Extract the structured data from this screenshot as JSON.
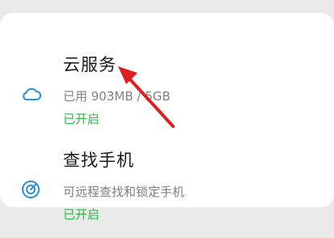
{
  "items": [
    {
      "title": "云服务",
      "subtitle": "已用 903MB / 5GB",
      "status": "已开启",
      "icon": "cloud-icon"
    },
    {
      "title": "查找手机",
      "subtitle": "可远程查找和锁定手机",
      "status": "已开启",
      "icon": "locate-icon"
    }
  ],
  "colors": {
    "accent": "#2a8fd6",
    "status_on": "#2fb54a",
    "annotation_arrow": "#e02020"
  }
}
